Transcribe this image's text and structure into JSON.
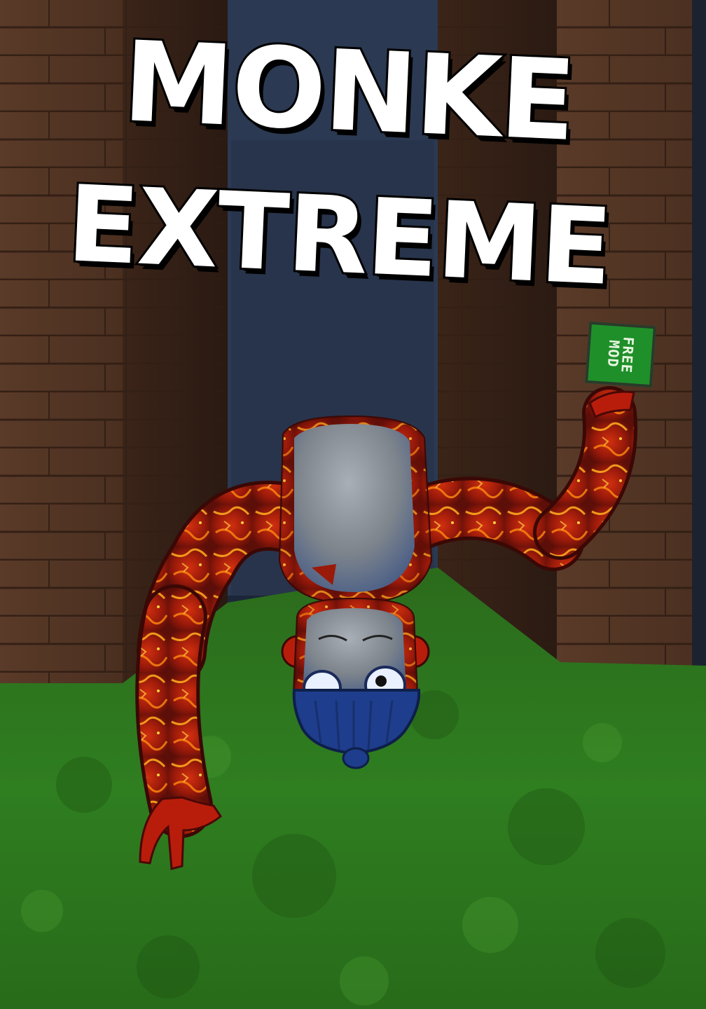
{
  "title": {
    "line1": "MONKE",
    "line2": "EXTREME"
  },
  "badge": {
    "text": "FREE\nMOD"
  },
  "colors": {
    "title_fill": "#ffffff",
    "title_outline": "#000000",
    "badge_green": "#1f8f2a",
    "lava_red": "#b3200c",
    "grass_green": "#2e7a1c",
    "wood_brown": "#5e3a26",
    "wall_blue": "#2b3952"
  }
}
